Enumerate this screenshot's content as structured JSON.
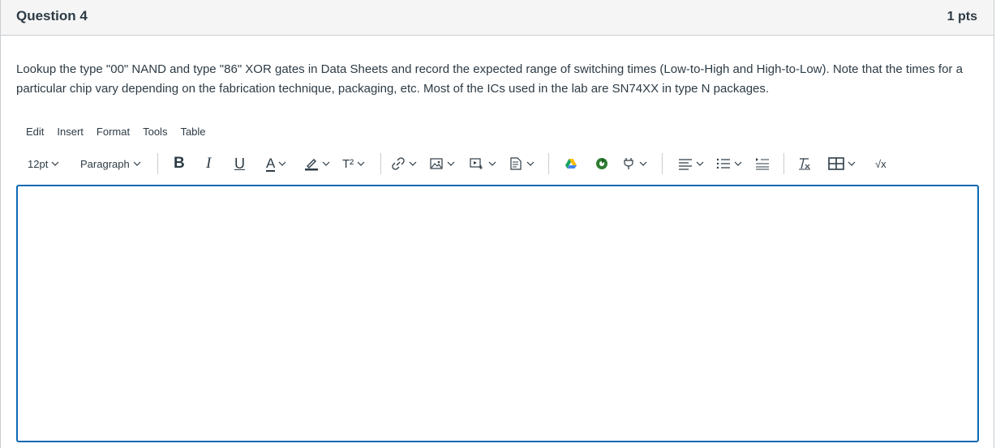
{
  "question": {
    "title": "Question 4",
    "points": "1 pts",
    "text": "Lookup the type \"00\" NAND and type \"86\" XOR gates in Data Sheets and record the expected range of switching times (Low-to-High and High-to-Low). Note that the times for a particular chip vary depending on the fabrication technique, packaging, etc. Most of the ICs used in the lab are SN74XX in type N packages."
  },
  "menubar": {
    "edit": "Edit",
    "insert": "Insert",
    "format": "Format",
    "tools": "Tools",
    "table": "Table"
  },
  "toolbar": {
    "font_size": "12pt",
    "block_format": "Paragraph",
    "bold": "B",
    "italic": "I",
    "underline": "U",
    "text_color": "A",
    "superscript": "T²",
    "math": "√x"
  },
  "colors": {
    "accent": "#0e68b3",
    "text": "#2d3b45",
    "header_bg": "#f5f5f5",
    "border": "#c7cdd1"
  }
}
